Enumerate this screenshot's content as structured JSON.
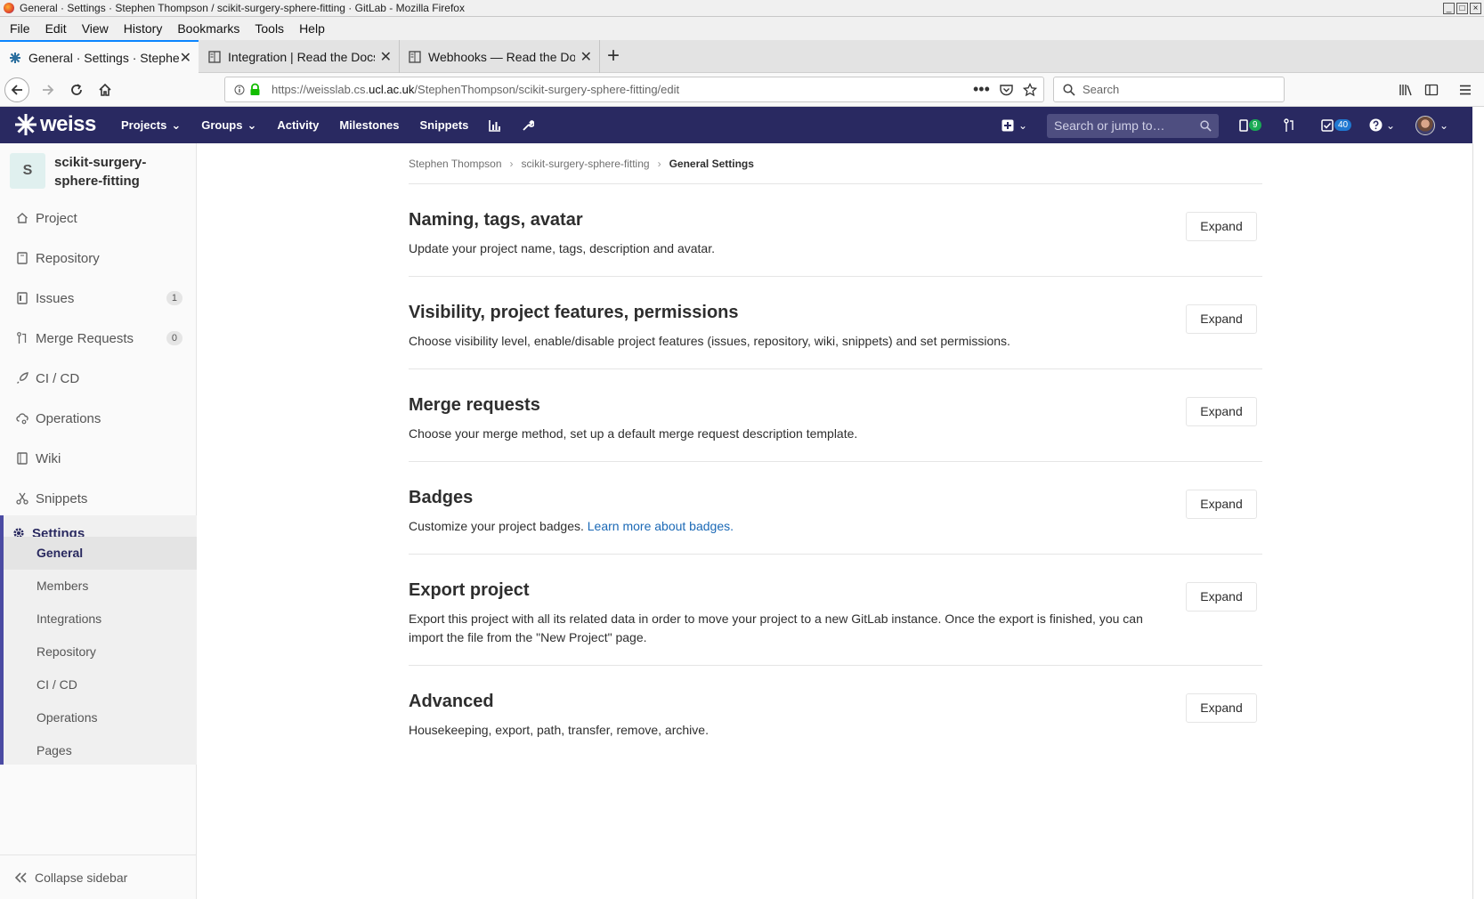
{
  "window": {
    "title": "General · Settings · Stephen Thompson / scikit-surgery-sphere-fitting · GitLab - Mozilla Firefox"
  },
  "menubar": [
    "File",
    "Edit",
    "View",
    "History",
    "Bookmarks",
    "Tools",
    "Help"
  ],
  "tabs": [
    {
      "label": "General · Settings · Stephen Th"
    },
    {
      "label": "Integration | Read the Docs"
    },
    {
      "label": "Webhooks — Read the Docs"
    }
  ],
  "navbar": {
    "url_prefix": "https://weisslab.cs.",
    "url_domain": "ucl.ac.uk",
    "url_path": "/StephenThompson/scikit-surgery-sphere-fitting/edit",
    "search_placeholder": "Search"
  },
  "gitlab_header": {
    "logo_text": "weiss",
    "nav": [
      "Projects",
      "Groups",
      "Activity",
      "Milestones",
      "Snippets"
    ],
    "search_placeholder": "Search or jump to…",
    "issues_count": "9",
    "todos_count": "40"
  },
  "sidebar": {
    "project_initial": "S",
    "project_name": "scikit-surgery-sphere-fitting",
    "items": [
      {
        "label": "Project"
      },
      {
        "label": "Repository"
      },
      {
        "label": "Issues",
        "count": "1"
      },
      {
        "label": "Merge Requests",
        "count": "0"
      },
      {
        "label": "CI / CD"
      },
      {
        "label": "Operations"
      },
      {
        "label": "Wiki"
      },
      {
        "label": "Snippets"
      }
    ],
    "settings_label": "Settings",
    "settings_sub": [
      "General",
      "Members",
      "Integrations",
      "Repository",
      "CI / CD",
      "Operations",
      "Pages"
    ],
    "collapse_label": "Collapse sidebar"
  },
  "breadcrumb": [
    "Stephen Thompson",
    "scikit-surgery-sphere-fitting",
    "General Settings"
  ],
  "sections": [
    {
      "title": "Naming, tags, avatar",
      "desc": "Update your project name, tags, description and avatar."
    },
    {
      "title": "Visibility, project features, permissions",
      "desc": "Choose visibility level, enable/disable project features (issues, repository, wiki, snippets) and set permissions."
    },
    {
      "title": "Merge requests",
      "desc": "Choose your merge method, set up a default merge request description template."
    },
    {
      "title": "Badges",
      "desc": "Customize your project badges.",
      "link": "Learn more about badges."
    },
    {
      "title": "Export project",
      "desc": "Export this project with all its related data in order to move your project to a new GitLab instance. Once the export is finished, you can import the file from the \"New Project\" page."
    },
    {
      "title": "Advanced",
      "desc": "Housekeeping, export, path, transfer, remove, archive."
    }
  ],
  "expand_label": "Expand"
}
